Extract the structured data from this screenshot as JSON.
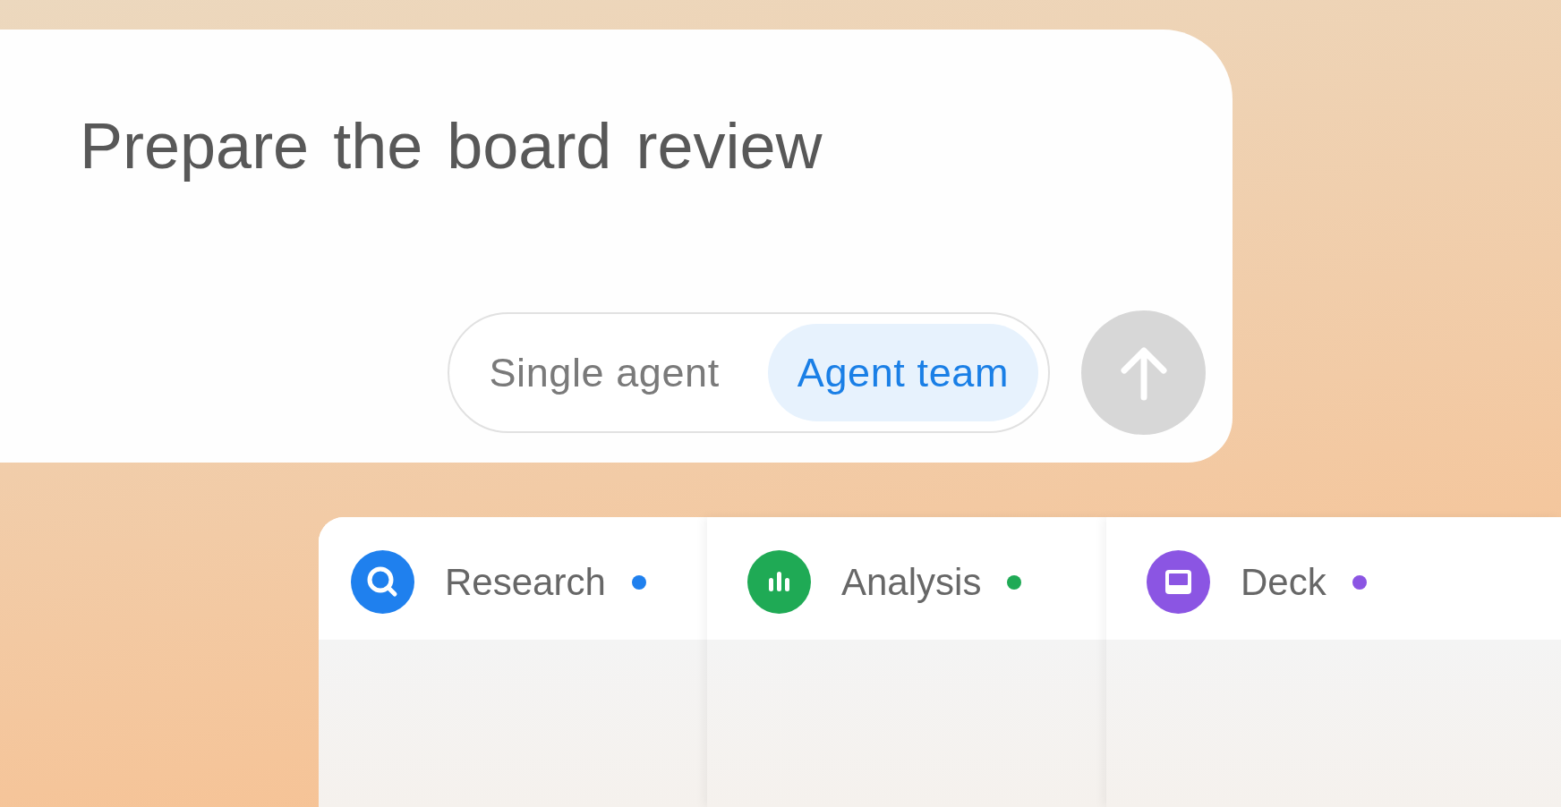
{
  "prompt": {
    "value": "Prepare the board review"
  },
  "mode_toggle": [
    {
      "label": "Single agent",
      "selected": false
    },
    {
      "label": "Agent team",
      "selected": true
    }
  ],
  "send_button": {
    "disabled": true
  },
  "agents": [
    {
      "name": "Research",
      "kind": "search",
      "color": "#1f80ee"
    },
    {
      "name": "Analysis",
      "kind": "chart",
      "color": "#1faa55"
    },
    {
      "name": "Deck",
      "kind": "slide",
      "color": "#8b55e3"
    }
  ]
}
